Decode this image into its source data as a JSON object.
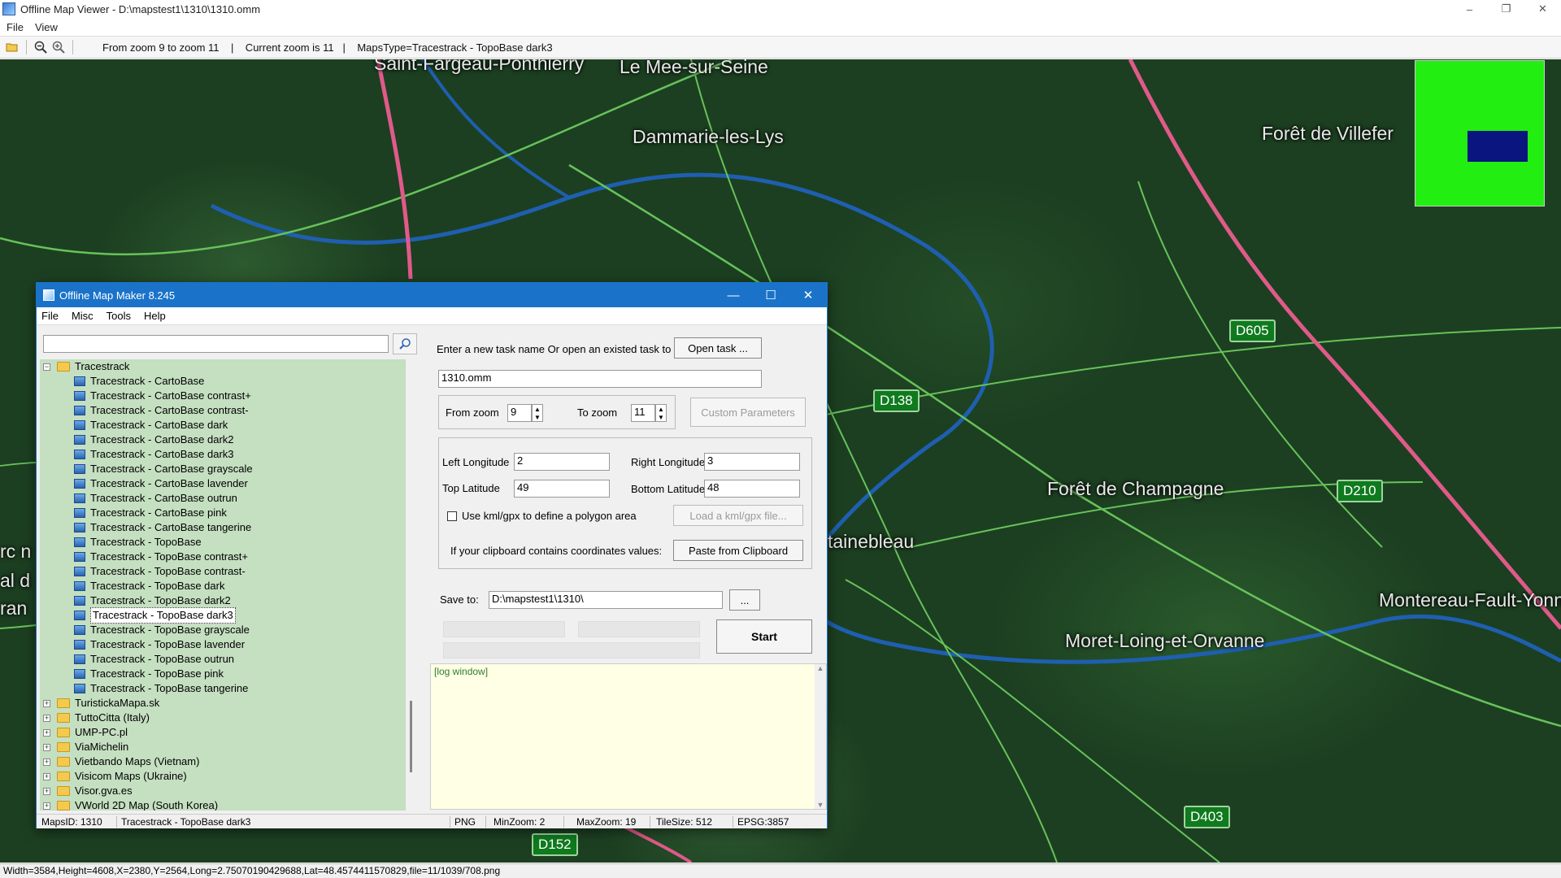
{
  "window": {
    "title": "Offline Map Viewer - D:\\mapstest1\\1310\\1310.omm",
    "controls": {
      "minimize": "–",
      "maximize": "❐",
      "close": "✕"
    }
  },
  "menu": {
    "file": "File",
    "view": "View"
  },
  "toolbar": {
    "icons": [
      "open-folder-icon",
      "zoom-out-icon",
      "zoom-in-icon"
    ],
    "info": "From zoom 9 to zoom 11    |    Current zoom is 11   |    MapsType=Tracestrack - TopoBase dark3"
  },
  "map": {
    "places": [
      "Saint-Fargeau-Ponthierry",
      "Le Mee-sur-Seine",
      "Dammarie-les-Lys",
      "Forêt de Villefer",
      "Forêt de Champagne",
      "tainebleau",
      "Moret-Loing-et-Orvanne",
      "Montereau-Fault-Yonne",
      "rc n",
      "al d",
      "ran"
    ],
    "shields": [
      "D605",
      "D138",
      "D210",
      "D403",
      "D152"
    ]
  },
  "statusbar": {
    "text": "Width=3584,Height=4608,X=2380,Y=2564,Long=2.75070190429688,Lat=48.4574411570829,file=11/1039/708.png"
  },
  "dialog": {
    "title": "Offline Map Maker 8.245",
    "controls": {
      "minimize": "—",
      "maximize": "☐",
      "close": "✕"
    },
    "menu": {
      "file": "File",
      "misc": "Misc",
      "tools": "Tools",
      "help": "Help"
    },
    "search": {
      "value": "",
      "placeholder": ""
    },
    "tree": {
      "root": "Tracestrack",
      "children": [
        "Tracestrack - CartoBase",
        "Tracestrack - CartoBase contrast+",
        "Tracestrack - CartoBase contrast-",
        "Tracestrack - CartoBase dark",
        "Tracestrack - CartoBase dark2",
        "Tracestrack - CartoBase dark3",
        "Tracestrack - CartoBase grayscale",
        "Tracestrack - CartoBase lavender",
        "Tracestrack - CartoBase outrun",
        "Tracestrack - CartoBase pink",
        "Tracestrack - CartoBase tangerine",
        "Tracestrack - TopoBase",
        "Tracestrack - TopoBase contrast+",
        "Tracestrack - TopoBase contrast-",
        "Tracestrack - TopoBase dark",
        "Tracestrack - TopoBase dark2",
        "Tracestrack - TopoBase dark3",
        "Tracestrack - TopoBase grayscale",
        "Tracestrack - TopoBase lavender",
        "Tracestrack - TopoBase outrun",
        "Tracestrack - TopoBase pink",
        "Tracestrack - TopoBase tangerine"
      ],
      "selected_index": 16,
      "folders": [
        "TuristickaMapa.sk",
        "TuttoCitta (Italy)",
        "UMP-PC.pl",
        "ViaMichelin",
        "Vietbando Maps (Vietnam)",
        "Visicom Maps (Ukraine)",
        "Visor.gva.es",
        "VWorld 2D Map (South Korea)"
      ]
    },
    "task": {
      "prompt": "Enter a new task name Or open an existed task to continue:",
      "open_button": "Open task ...",
      "name_value": "1310.omm"
    },
    "zoom": {
      "from_label": "From zoom",
      "from_value": "9",
      "to_label": "To zoom",
      "to_value": "11",
      "custom_button": "Custom Parameters"
    },
    "bounds": {
      "left_label": "Left Longitude",
      "left_value": "2",
      "right_label": "Right Longitude",
      "right_value": "3",
      "top_label": "Top Latitude",
      "top_value": "49",
      "bottom_label": "Bottom Latitude",
      "bottom_value": "48",
      "kml_label": "Use kml/gpx to define a polygon area",
      "kml_checked": false,
      "kml_button": "Load a kml/gpx file...",
      "clip_label": "If your clipboard contains coordinates values:",
      "clip_button": "Paste from Clipboard"
    },
    "save": {
      "label": "Save to:",
      "value": "D:\\mapstest1\\1310\\",
      "browse_button": "..."
    },
    "start_button": "Start",
    "log": {
      "title": "[log window]"
    },
    "status": {
      "mapsid": "MapsID: 1310",
      "mapname": "Tracestrack - TopoBase dark3",
      "format": "PNG",
      "minzoom": "MinZoom: 2",
      "maxzoom": "MaxZoom: 19",
      "tilesize": "TileSize: 512",
      "epsg": "EPSG:3857"
    }
  }
}
